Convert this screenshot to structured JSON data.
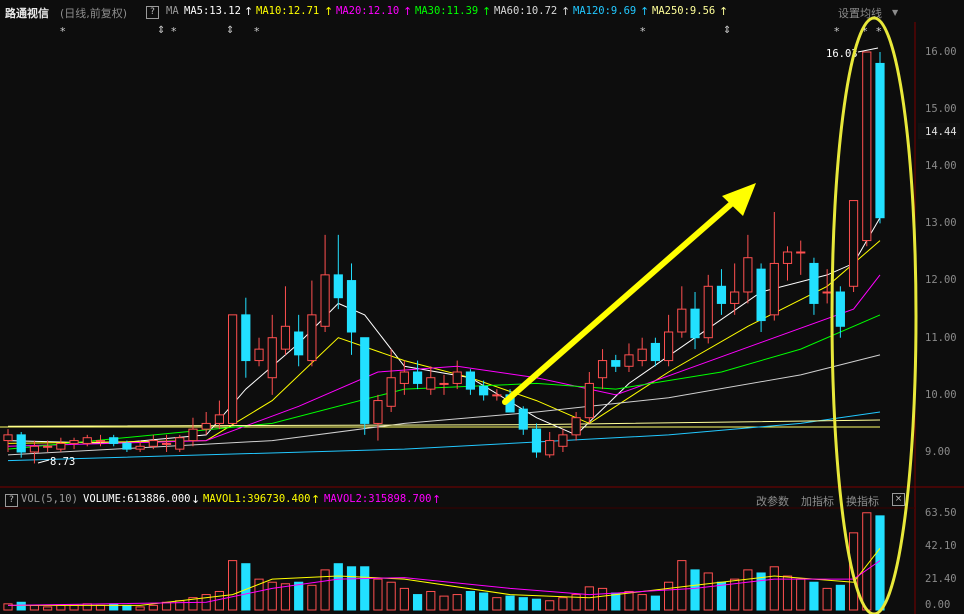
{
  "header": {
    "stock_name": "路通视信",
    "period": "(日线,前复权)",
    "help_icon": "?",
    "ma_label": "MA",
    "ma5": "MA5:13.12",
    "ma10": "MA10:12.71",
    "ma20": "MA20:12.10",
    "ma30": "MA30:11.39",
    "ma60": "MA60:10.72",
    "ma120": "MA120:9.69",
    "ma250": "MA250:9.56",
    "settings": "设置均线",
    "colors": {
      "ma5": "#ffffff",
      "ma10": "#ffff00",
      "ma20": "#ff00ff",
      "ma30": "#00ff00",
      "ma60": "#d0d0d0",
      "ma120": "#22c8ff",
      "ma250": "#ffff99"
    }
  },
  "markers": [
    "*",
    "*",
    "*",
    "*",
    "*",
    "*",
    "*",
    "*",
    "*"
  ],
  "price_axis": {
    "ticks": [
      "16.00",
      "15.00",
      "14.00",
      "13.00",
      "12.00",
      "11.00",
      "10.00",
      "9.00"
    ],
    "current": "14.44"
  },
  "annotations": {
    "high": "16.03",
    "low": "8.73"
  },
  "volume": {
    "help_icon": "?",
    "title": "VOL(5,10)",
    "volume": "VOLUME:613886.000",
    "mavol1": "MAVOL1:396730.400",
    "mavol2": "MAVOL2:315898.700",
    "actions": {
      "params": "改参数",
      "add": "加指标",
      "switch": "换指标",
      "close": "×"
    },
    "ticks": [
      "63.50",
      "42.10",
      "21.40",
      "0.00"
    ]
  },
  "chart_data": {
    "type": "candlestick",
    "ylim": [
      8.3,
      16.5
    ],
    "vol_ylim": [
      0,
      66
    ],
    "candles": [
      [
        9.2,
        9.3,
        9.0,
        9.4,
        4
      ],
      [
        9.3,
        9.0,
        8.9,
        9.35,
        5
      ],
      [
        9.0,
        9.1,
        8.8,
        9.2,
        3
      ],
      [
        9.1,
        9.1,
        9.0,
        9.2,
        2
      ],
      [
        9.05,
        9.15,
        9.0,
        9.25,
        3
      ],
      [
        9.15,
        9.2,
        9.05,
        9.25,
        3
      ],
      [
        9.15,
        9.25,
        9.1,
        9.3,
        4
      ],
      [
        9.2,
        9.2,
        9.1,
        9.3,
        3
      ],
      [
        9.25,
        9.15,
        9.1,
        9.3,
        4
      ],
      [
        9.15,
        9.05,
        9.0,
        9.2,
        3
      ],
      [
        9.05,
        9.1,
        9.0,
        9.2,
        2
      ],
      [
        9.1,
        9.2,
        9.05,
        9.3,
        3
      ],
      [
        9.15,
        9.15,
        9.0,
        9.3,
        5
      ],
      [
        9.05,
        9.25,
        9.0,
        9.3,
        6
      ],
      [
        9.2,
        9.4,
        9.1,
        9.6,
        8
      ],
      [
        9.4,
        9.5,
        9.3,
        9.7,
        10
      ],
      [
        9.5,
        9.65,
        9.4,
        9.9,
        12
      ],
      [
        9.5,
        11.4,
        9.5,
        11.4,
        32
      ],
      [
        11.4,
        10.6,
        10.3,
        11.7,
        30
      ],
      [
        10.6,
        10.8,
        10.5,
        11.0,
        20
      ],
      [
        10.3,
        11.0,
        10.0,
        11.4,
        18
      ],
      [
        10.8,
        11.2,
        10.7,
        11.9,
        17
      ],
      [
        11.1,
        10.7,
        10.5,
        11.4,
        18
      ],
      [
        10.6,
        11.4,
        10.5,
        12.0,
        16
      ],
      [
        11.2,
        12.1,
        11.1,
        12.8,
        26
      ],
      [
        12.1,
        11.7,
        11.5,
        12.8,
        30
      ],
      [
        12.0,
        11.1,
        10.7,
        12.3,
        28
      ],
      [
        11.0,
        9.5,
        9.3,
        11.0,
        28
      ],
      [
        9.5,
        9.9,
        9.2,
        10.0,
        20
      ],
      [
        9.8,
        10.3,
        9.7,
        10.8,
        18
      ],
      [
        10.2,
        10.4,
        10.0,
        10.6,
        14
      ],
      [
        10.4,
        10.2,
        10.1,
        10.6,
        10
      ],
      [
        10.1,
        10.3,
        10.0,
        10.5,
        12
      ],
      [
        10.2,
        10.2,
        10.0,
        10.35,
        9
      ],
      [
        10.2,
        10.4,
        10.1,
        10.6,
        10
      ],
      [
        10.4,
        10.1,
        10.0,
        10.45,
        12
      ],
      [
        10.15,
        10.0,
        9.9,
        10.25,
        11
      ],
      [
        10.0,
        10.0,
        9.9,
        10.1,
        8
      ],
      [
        10.0,
        9.7,
        9.7,
        10.1,
        9
      ],
      [
        9.75,
        9.4,
        9.3,
        9.8,
        8
      ],
      [
        9.4,
        9.0,
        8.9,
        9.5,
        7
      ],
      [
        8.95,
        9.2,
        8.9,
        9.35,
        6
      ],
      [
        9.1,
        9.3,
        9.0,
        9.4,
        8
      ],
      [
        9.3,
        9.6,
        9.2,
        9.7,
        10
      ],
      [
        9.6,
        10.2,
        9.5,
        10.4,
        15
      ],
      [
        10.3,
        10.6,
        10.1,
        10.8,
        14
      ],
      [
        10.6,
        10.5,
        10.4,
        10.7,
        11
      ],
      [
        10.5,
        10.7,
        10.4,
        10.9,
        12
      ],
      [
        10.6,
        10.8,
        10.5,
        11.0,
        10
      ],
      [
        10.9,
        10.6,
        10.5,
        11.0,
        9
      ],
      [
        10.6,
        11.1,
        10.5,
        11.4,
        18
      ],
      [
        11.1,
        11.5,
        11.0,
        11.9,
        32
      ],
      [
        11.5,
        11.0,
        10.8,
        11.8,
        26
      ],
      [
        11.0,
        11.9,
        10.9,
        12.1,
        24
      ],
      [
        11.9,
        11.6,
        11.4,
        12.2,
        18
      ],
      [
        11.6,
        11.8,
        11.4,
        12.3,
        20
      ],
      [
        11.8,
        12.4,
        11.6,
        12.8,
        26
      ],
      [
        12.2,
        11.3,
        11.1,
        12.3,
        24
      ],
      [
        11.4,
        12.3,
        11.3,
        13.2,
        28
      ],
      [
        12.3,
        12.5,
        12.0,
        12.6,
        22
      ],
      [
        12.5,
        12.5,
        12.1,
        12.7,
        20
      ],
      [
        12.3,
        11.6,
        11.4,
        12.4,
        18
      ],
      [
        11.8,
        11.8,
        11.6,
        12.2,
        14
      ],
      [
        11.8,
        11.2,
        11.0,
        11.9,
        16
      ],
      [
        11.9,
        13.4,
        11.8,
        13.4,
        50
      ],
      [
        12.7,
        16.0,
        12.6,
        16.0,
        63
      ],
      [
        15.8,
        13.1,
        13.0,
        16.0,
        61
      ]
    ],
    "ma": {
      "ma5": [
        [
          0,
          9.2
        ],
        [
          8,
          9.15
        ],
        [
          15,
          9.3
        ],
        [
          18,
          10.1
        ],
        [
          22,
          10.9
        ],
        [
          25,
          11.6
        ],
        [
          27,
          11.4
        ],
        [
          30,
          10.5
        ],
        [
          35,
          10.3
        ],
        [
          40,
          9.6
        ],
        [
          43,
          9.3
        ],
        [
          47,
          10.2
        ],
        [
          52,
          11.0
        ],
        [
          57,
          11.8
        ],
        [
          62,
          12.1
        ],
        [
          64,
          12.3
        ],
        [
          66,
          13.1
        ]
      ],
      "ma10": [
        [
          0,
          9.15
        ],
        [
          15,
          9.2
        ],
        [
          20,
          9.9
        ],
        [
          25,
          11.0
        ],
        [
          30,
          10.6
        ],
        [
          35,
          10.3
        ],
        [
          40,
          9.9
        ],
        [
          44,
          9.5
        ],
        [
          50,
          10.4
        ],
        [
          56,
          11.2
        ],
        [
          62,
          11.9
        ],
        [
          66,
          12.7
        ]
      ],
      "ma20": [
        [
          0,
          9.1
        ],
        [
          15,
          9.2
        ],
        [
          22,
          9.8
        ],
        [
          28,
          10.4
        ],
        [
          34,
          10.5
        ],
        [
          40,
          10.3
        ],
        [
          46,
          10.0
        ],
        [
          52,
          10.5
        ],
        [
          58,
          11.0
        ],
        [
          64,
          11.5
        ],
        [
          66,
          12.1
        ]
      ],
      "ma30": [
        [
          0,
          9.05
        ],
        [
          20,
          9.5
        ],
        [
          30,
          10.1
        ],
        [
          40,
          10.2
        ],
        [
          46,
          10.1
        ],
        [
          54,
          10.4
        ],
        [
          60,
          10.8
        ],
        [
          66,
          11.4
        ]
      ],
      "ma60": [
        [
          0,
          8.95
        ],
        [
          20,
          9.2
        ],
        [
          30,
          9.5
        ],
        [
          40,
          9.7
        ],
        [
          50,
          9.95
        ],
        [
          60,
          10.35
        ],
        [
          66,
          10.7
        ]
      ],
      "ma120": [
        [
          0,
          8.85
        ],
        [
          30,
          9.05
        ],
        [
          50,
          9.3
        ],
        [
          60,
          9.5
        ],
        [
          66,
          9.7
        ]
      ],
      "ma250": [
        [
          0,
          9.45
        ],
        [
          40,
          9.48
        ],
        [
          66,
          9.56
        ]
      ]
    },
    "mavol": {
      "mavol1": [
        [
          0,
          3
        ],
        [
          10,
          3
        ],
        [
          17,
          10
        ],
        [
          20,
          20
        ],
        [
          25,
          22
        ],
        [
          30,
          20
        ],
        [
          38,
          10
        ],
        [
          44,
          8
        ],
        [
          52,
          16
        ],
        [
          58,
          22
        ],
        [
          64,
          18
        ],
        [
          66,
          40
        ]
      ],
      "mavol2": [
        [
          0,
          3
        ],
        [
          15,
          5
        ],
        [
          20,
          14
        ],
        [
          25,
          20
        ],
        [
          30,
          21
        ],
        [
          38,
          14
        ],
        [
          44,
          10
        ],
        [
          52,
          14
        ],
        [
          58,
          20
        ],
        [
          64,
          20
        ],
        [
          66,
          32
        ]
      ]
    }
  }
}
